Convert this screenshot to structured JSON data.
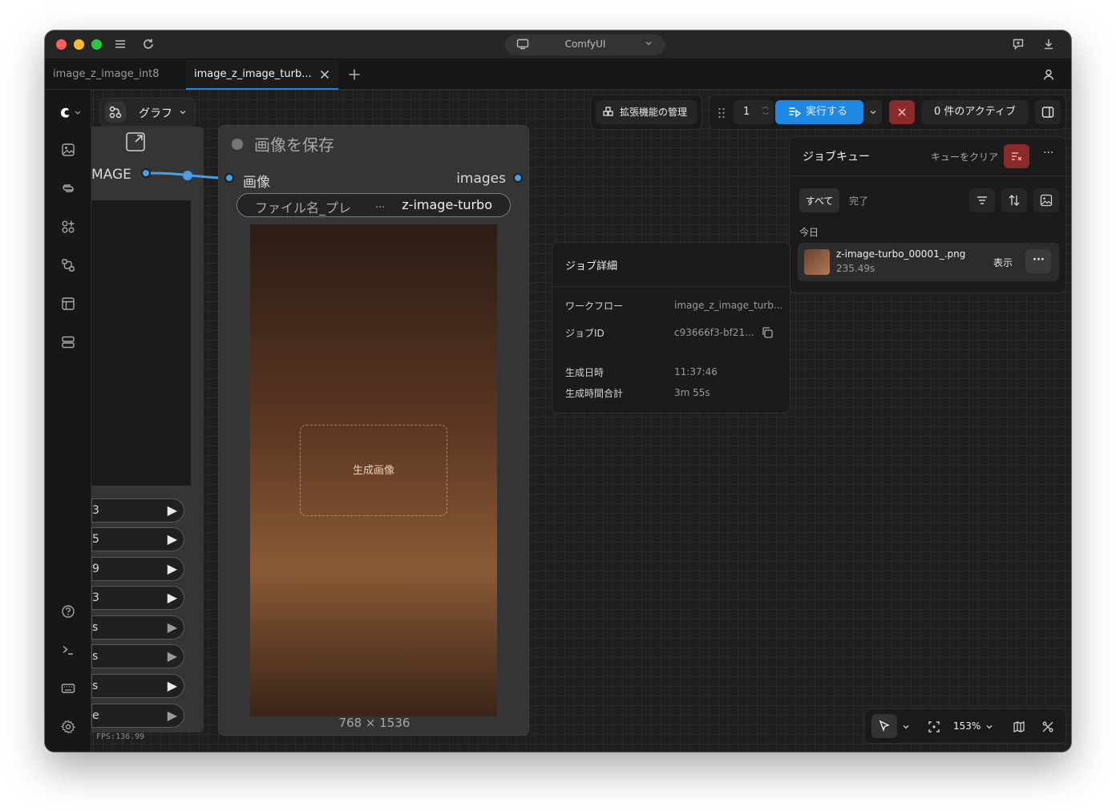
{
  "titlebar": {
    "app_title": "ComfyUI"
  },
  "tabs": [
    {
      "label": "image_z_image_int8",
      "active": false
    },
    {
      "label": "image_z_image_turb...",
      "active": true
    }
  ],
  "toolbar": {
    "graph_label": "グラフ",
    "extensions_label": "拡張機能の管理",
    "queue_count": "1",
    "run_label": "実行する",
    "active_label": "0 件のアクティブ"
  },
  "left_node": {
    "output_label": "MAGE",
    "rows": [
      "3",
      "5",
      "9",
      "3",
      "s",
      "s",
      "s",
      "e"
    ]
  },
  "save_node": {
    "title": "画像を保存",
    "input_label": "画像",
    "output_label": "images",
    "filename_prefix_label": "ファイル名_プレ",
    "filename_prefix_ellipsis": "...",
    "filename_prefix_value": "z-image-turbo",
    "image_size": "768 × 1536",
    "image_placeholder": "生成画像"
  },
  "job_queue": {
    "title": "ジョブキュー",
    "clear_label": "キューをクリア",
    "filter_all": "すべて",
    "filter_done": "完了",
    "section_today": "今日",
    "item": {
      "filename": "z-image-turbo_00001_.png",
      "duration": "235.49s",
      "view_label": "表示"
    }
  },
  "job_details": {
    "title": "ジョブ詳細",
    "workflow_label": "ワークフロー",
    "workflow_value": "image_z_image_turb...",
    "job_id_label": "ジョブID",
    "job_id_value": "c93666f3-bf21...",
    "created_label": "生成日時",
    "created_value": "11:37:46",
    "total_time_label": "生成時間合計",
    "total_time_value": "3m 55s"
  },
  "bottom_toolbar": {
    "zoom": "153%"
  },
  "status": {
    "fps": "FPS:136.99"
  },
  "colors": {
    "accent": "#1e88e5",
    "link": "#4a9ee8",
    "danger": "#8b2a2a"
  }
}
